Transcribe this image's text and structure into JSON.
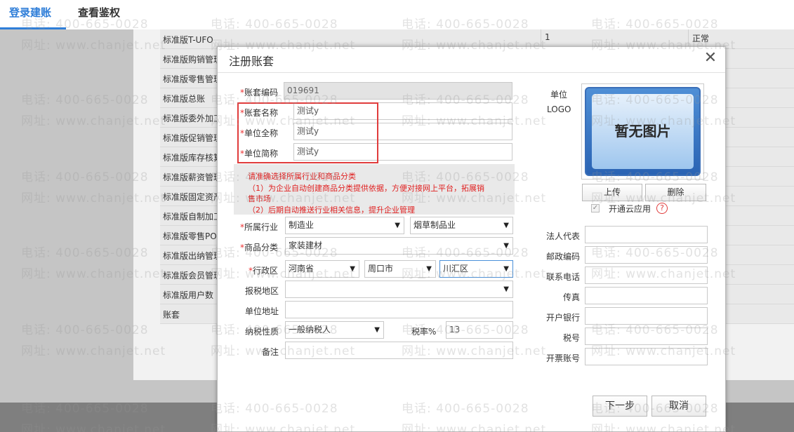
{
  "tabs": [
    {
      "label": "登录建账",
      "active": true
    },
    {
      "label": "查看鉴权",
      "active": false
    }
  ],
  "background_rows": [
    {
      "name": "标准版T-UFO",
      "col2": "1",
      "col3": "正常"
    },
    {
      "name": "标准版购销管理",
      "col2": "",
      "col3": ""
    },
    {
      "name": "标准版零售管理",
      "col2": "",
      "col3": ""
    },
    {
      "name": "标准版总账",
      "col2": "",
      "col3": ""
    },
    {
      "name": "标准版委外加工",
      "col2": "",
      "col3": ""
    },
    {
      "name": "标准版促销管理",
      "col2": "",
      "col3": ""
    },
    {
      "name": "标准版库存核算",
      "col2": "",
      "col3": ""
    },
    {
      "name": "标准版薪资管理",
      "col2": "",
      "col3": ""
    },
    {
      "name": "标准版固定资产",
      "col2": "",
      "col3": ""
    },
    {
      "name": "标准版自制加工",
      "col2": "",
      "col3": ""
    },
    {
      "name": "标准版零售POS",
      "col2": "",
      "col3": ""
    },
    {
      "name": "标准版出纳管理",
      "col2": "",
      "col3": ""
    },
    {
      "name": "标准版会员管理",
      "col2": "",
      "col3": ""
    },
    {
      "name": "标准版用户数",
      "col2": "",
      "col3": ""
    },
    {
      "name": "账套",
      "col2": "",
      "col3": ""
    }
  ],
  "watermark": {
    "phone": "电话: 400-665-0028",
    "url": "网址: www.chanjet.net"
  },
  "dialog": {
    "title": "注册账套",
    "close": "✕",
    "fields": {
      "account_code": {
        "label": "账套编码",
        "value": "019691"
      },
      "account_name": {
        "label": "账套名称",
        "value": "测试y"
      },
      "company_full": {
        "label": "单位全称",
        "value": "测试y"
      },
      "company_short": {
        "label": "单位简称",
        "value": "测试y"
      },
      "industry": {
        "label": "所属行业",
        "value1": "制造业",
        "value2": "烟草制品业"
      },
      "product_category": {
        "label": "商品分类",
        "value": "家装建材"
      },
      "region": {
        "label": "行政区",
        "province": "河南省",
        "city": "周口市",
        "district": "川汇区"
      },
      "tax_region": {
        "label": "报税地区",
        "value": ""
      },
      "address": {
        "label": "单位地址",
        "value": ""
      },
      "tax_type": {
        "label": "纳税性质",
        "value": "一般纳税人"
      },
      "tax_rate": {
        "label": "税率%",
        "value": "13"
      },
      "remark": {
        "label": "备注",
        "value": ""
      }
    },
    "hint": [
      "请准确选择所属行业和商品分类",
      "（1）为企业自动创建商品分类提供依据，方便对接网上平台，拓展销",
      "售市场",
      "（2）后期自动推送行业相关信息，提升企业管理"
    ],
    "logo": {
      "label1": "单位",
      "label2": "LOGO",
      "placeholder": "暂无图片",
      "upload": "上传",
      "delete": "删除",
      "cloud_label": "开通云应用",
      "cloud_checked": true,
      "help": "?"
    },
    "right_fields": [
      "法人代表",
      "邮政编码",
      "联系电话",
      "传真",
      "开户银行",
      "税号",
      "开票账号"
    ],
    "buttons": {
      "next": "下一步",
      "cancel": "取消"
    }
  }
}
